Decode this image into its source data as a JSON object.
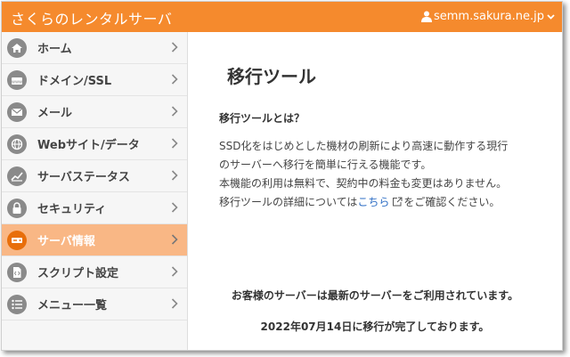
{
  "header": {
    "brand": "さくらのレンタルサーバ",
    "account": "semm.sakura.ne.jp"
  },
  "sidebar": {
    "items": [
      {
        "label": "ホーム",
        "icon": "home-icon"
      },
      {
        "label": "ドメイン/SSL",
        "icon": "domain-icon"
      },
      {
        "label": "メール",
        "icon": "mail-icon"
      },
      {
        "label": "Webサイト/データ",
        "icon": "globe-icon"
      },
      {
        "label": "サーバステータス",
        "icon": "chart-icon"
      },
      {
        "label": "セキュリティ",
        "icon": "lock-icon"
      },
      {
        "label": "サーバ情報",
        "icon": "server-icon",
        "active": true
      },
      {
        "label": "スクリプト設定",
        "icon": "script-icon"
      },
      {
        "label": "メニュー一覧",
        "icon": "list-icon"
      }
    ]
  },
  "main": {
    "title": "移行ツール",
    "section_title": "移行ツールとは？",
    "desc_line1": "SSD化をはじめとした機材の刷新により高速に動作する現行",
    "desc_line2": "のサーバーへ移行を簡単に行える機能です。",
    "desc_line3": "本機能の利用は無料で、契約中の料金も変更はありません。",
    "desc_line4_pre": "移行ツールの詳細については",
    "desc_link": "こちら",
    "desc_line4_post": "をご確認ください。",
    "notice": "お客様のサーバーは最新のサーバーをご利用されています。",
    "completed": "2022年07月14日に移行が完了しております。"
  },
  "colors": {
    "accent": "#f58a2d",
    "active_bg": "#f9b785",
    "active_icon": "#e86e0a",
    "link": "#2b6cc4"
  }
}
